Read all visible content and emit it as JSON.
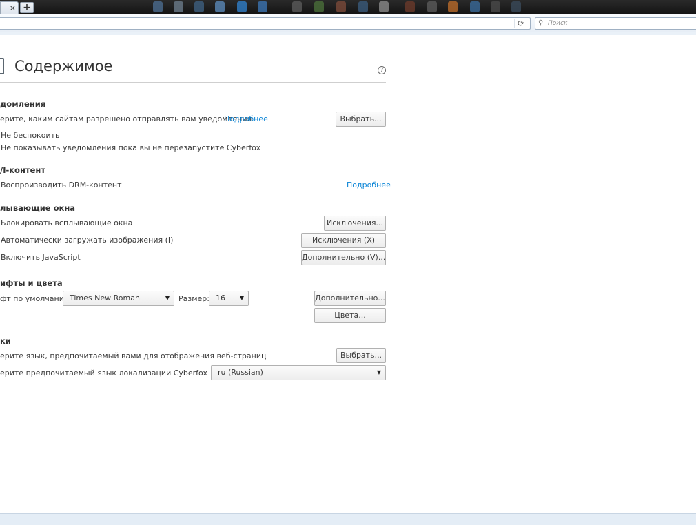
{
  "browser": {
    "tab_close": "×",
    "new_tab": "+",
    "search_placeholder": "Поиск"
  },
  "page": {
    "title": "Содержимое",
    "help": "?"
  },
  "notifications": {
    "heading": "домления",
    "desc": "ерите, каким сайтам разрешено отправлять вам уведомления",
    "more_link": "Подробнее",
    "choose_button": "Выбрать...",
    "dnd_label": "Не беспокоить",
    "dont_show_label": "Не показывать уведомления пока вы не перезапустите Cyberfox"
  },
  "drm": {
    "heading": "/I-контент",
    "play_label": "Воспроизводить DRM-контент",
    "more_link": "Подробнее"
  },
  "popups": {
    "heading": "лывающие окна",
    "block_label": "Блокировать всплывающие окна",
    "block_exceptions": "Исключения...",
    "images_label": "Автоматически загружать изображения (I)",
    "images_exceptions": "Исключения (X)",
    "js_label": "Включить JavaScript",
    "js_advanced": "Дополнительно (V)..."
  },
  "fonts": {
    "heading": "ифты и цвета",
    "default_font_label": "фт по умолчанию:",
    "default_font_value": "Times New Roman",
    "size_label": "Размер:",
    "size_value": "16",
    "advanced_button": "Дополнительно...",
    "colors_button": "Цвета..."
  },
  "languages": {
    "heading": "ки",
    "pref_label": "ерите язык, предпочитаемый вами для отображения веб-страниц",
    "choose_button": "Выбрать...",
    "ui_label": "ерите предпочитаемый язык локализации Cyberfox",
    "ui_value": "ru (Russian)"
  },
  "icons": {
    "reload": "reload-icon",
    "search": "search-icon",
    "dropdown": "chevron-down-icon",
    "content": "content-page-icon"
  }
}
